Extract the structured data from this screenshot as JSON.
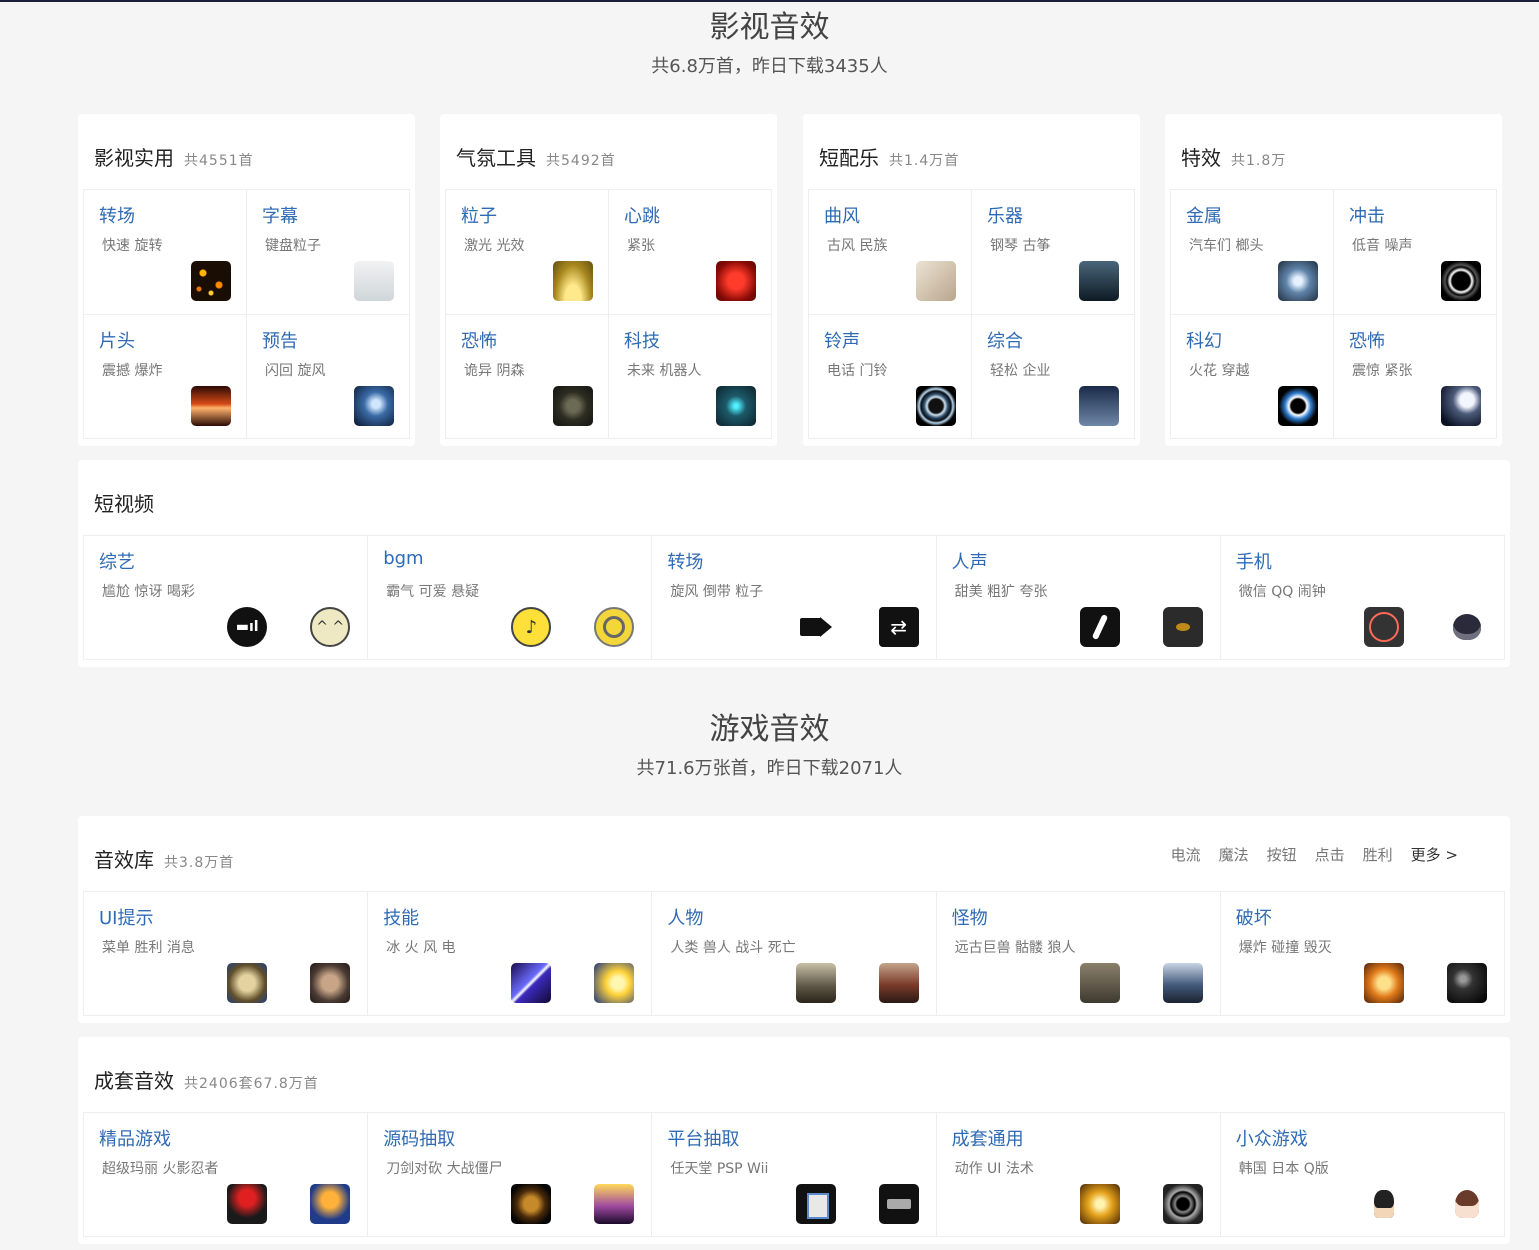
{
  "film": {
    "title": "影视音效",
    "subtitle": "共6.8万首，昨日下载3435人",
    "cards": [
      {
        "title": "影视实用",
        "count": "共4551首",
        "cells": [
          {
            "title": "转场",
            "tags": "快速 旋转",
            "thumb": "sparks-thumbnail"
          },
          {
            "title": "字幕",
            "tags": "键盘粒子",
            "thumb": "keyboard-thumbnail"
          },
          {
            "title": "片头",
            "tags": "震撼 爆炸",
            "thumb": "fire-text-thumbnail"
          },
          {
            "title": "预告",
            "tags": "闪回 旋风",
            "thumb": "lightning-thumbnail"
          }
        ]
      },
      {
        "title": "气氛工具",
        "count": "共5492首",
        "cells": [
          {
            "title": "粒子",
            "tags": "激光 光效",
            "thumb": "light-rays-thumbnail"
          },
          {
            "title": "心跳",
            "tags": "紧张",
            "thumb": "heart-thumbnail"
          },
          {
            "title": "恐怖",
            "tags": "诡异 阴森",
            "thumb": "dark-tunnel-thumbnail"
          },
          {
            "title": "科技",
            "tags": "未来 机器人",
            "thumb": "tech-hud-thumbnail"
          }
        ]
      },
      {
        "title": "短配乐",
        "count": "共1.4万首",
        "cells": [
          {
            "title": "曲风",
            "tags": "古风 民族",
            "thumb": "ink-painting-thumbnail"
          },
          {
            "title": "乐器",
            "tags": "钢琴 古筝",
            "thumb": "guitarist-thumbnail"
          },
          {
            "title": "铃声",
            "tags": "电话 门铃",
            "thumb": "ring-thumbnail"
          },
          {
            "title": "综合",
            "tags": "轻松 企业",
            "thumb": "businessman-thumbnail"
          }
        ]
      },
      {
        "title": "特效",
        "count": "共1.8万",
        "cells": [
          {
            "title": "金属",
            "tags": "汽车们 榔头",
            "thumb": "orb-thumbnail"
          },
          {
            "title": "冲击",
            "tags": "低音 噪声",
            "thumb": "burst-ring-thumbnail"
          },
          {
            "title": "科幻",
            "tags": "火花 穿越",
            "thumb": "portal-thumbnail"
          },
          {
            "title": "恐怖",
            "tags": "震惊 紧张",
            "thumb": "moon-night-thumbnail"
          }
        ]
      }
    ],
    "short_video": {
      "title": "短视频",
      "cells": [
        {
          "title": "综艺",
          "tags": "尴尬 惊讶 喝彩",
          "icons": [
            "signal-icon",
            "smile-face-icon"
          ]
        },
        {
          "title": "bgm",
          "tags": "霸气 可爱 悬疑",
          "icons": [
            "music-note-icon",
            "vinyl-disc-icon"
          ]
        },
        {
          "title": "转场",
          "tags": "旋风 倒带 粒子",
          "icons": [
            "video-camera-icon",
            "switch-camera-icon"
          ]
        },
        {
          "title": "人声",
          "tags": "甜美 粗犷 夸张",
          "icons": [
            "microphone-icon",
            "lips-icon"
          ]
        },
        {
          "title": "手机",
          "tags": "微信 QQ 闹钟",
          "icons": [
            "clock-icon",
            "headset-icon"
          ]
        }
      ]
    }
  },
  "game": {
    "title": "游戏音效",
    "subtitle": "共71.6万张首，昨日下载2071人",
    "library": {
      "title": "音效库",
      "count": "共3.8万首",
      "links": [
        "电流",
        "魔法",
        "按钮",
        "点击",
        "胜利"
      ],
      "more": "更多 >",
      "cells": [
        {
          "title": "UI提示",
          "tags": "菜单 胜利 消息"
        },
        {
          "title": "技能",
          "tags": "冰 火 风 电"
        },
        {
          "title": "人物",
          "tags": "人类 兽人 战斗 死亡"
        },
        {
          "title": "怪物",
          "tags": "远古巨兽 骷髅 狼人"
        },
        {
          "title": "破坏",
          "tags": "爆炸 碰撞 毁灭"
        }
      ]
    },
    "sets": {
      "title": "成套音效",
      "count": "共2406套67.8万首",
      "cells": [
        {
          "title": "精品游戏",
          "tags": "超级玛丽 火影忍者"
        },
        {
          "title": "源码抽取",
          "tags": "刀剑对砍 大战僵尸"
        },
        {
          "title": "平台抽取",
          "tags": "任天堂 PSP Wii"
        },
        {
          "title": "成套通用",
          "tags": "动作 UI 法术"
        },
        {
          "title": "小众游戏",
          "tags": "韩国 日本 Q版"
        }
      ]
    }
  }
}
